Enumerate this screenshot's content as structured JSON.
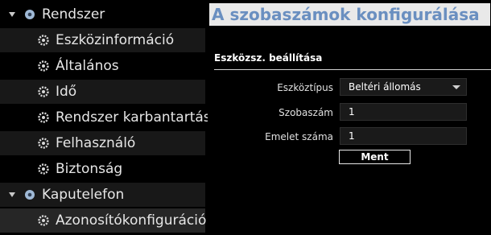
{
  "sidebar": {
    "groups": [
      {
        "label": "Rendszer",
        "items": [
          {
            "label": "Eszközinformáció"
          },
          {
            "label": "Általános"
          },
          {
            "label": "Idő"
          },
          {
            "label": "Rendszer karbantartása"
          },
          {
            "label": "Felhasználó"
          },
          {
            "label": "Biztonság"
          }
        ]
      },
      {
        "label": "Kaputelefon",
        "items": [
          {
            "label": "Azonosítókonfiguráció",
            "selected": true
          }
        ]
      }
    ]
  },
  "main": {
    "title": "A szobaszámok konfigurálása",
    "section": "Eszközsz. beállítása",
    "fields": [
      {
        "label": "Eszköztípus",
        "value": "Beltéri állomás",
        "type": "select"
      },
      {
        "label": "Szobaszám",
        "value": "1",
        "type": "text"
      },
      {
        "label": "Emelet száma",
        "value": "1",
        "type": "text"
      }
    ],
    "save_label": "Ment"
  },
  "colors": {
    "title_text": "#6a8fc0",
    "title_bg": "#e9e9e9",
    "selected_row": "#262626"
  }
}
